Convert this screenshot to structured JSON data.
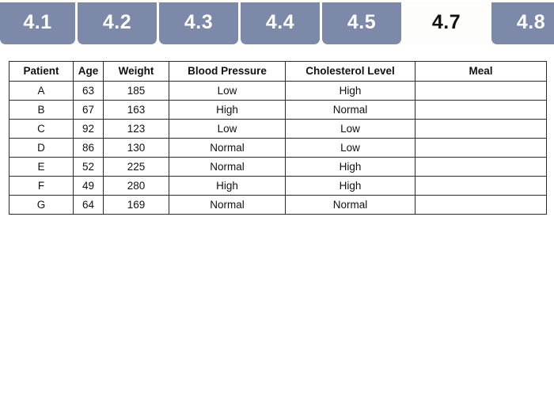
{
  "tabs": {
    "items": [
      {
        "label": "4.1",
        "active": false
      },
      {
        "label": "4.2",
        "active": false
      },
      {
        "label": "4.3",
        "active": false
      },
      {
        "label": "4.4",
        "active": false
      },
      {
        "label": "4.5",
        "active": false
      },
      {
        "label": "4.7",
        "active": true
      },
      {
        "label": "4.8",
        "active": false
      }
    ],
    "active_label": "4.7",
    "inactive_color": "#7d89a8",
    "active_color": "#fdfdfc",
    "inactive_text_color": "#ffffff",
    "active_text_color": "#111111"
  },
  "table": {
    "columns": [
      "Patient",
      "Age",
      "Weight",
      "Blood Pressure",
      "Cholesterol Level",
      "Meal"
    ],
    "rows": [
      {
        "patient": "A",
        "age": "63",
        "weight": "185",
        "blood_pressure": "Low",
        "cholesterol_level": "High",
        "meal": ""
      },
      {
        "patient": "B",
        "age": "67",
        "weight": "163",
        "blood_pressure": "High",
        "cholesterol_level": "Normal",
        "meal": ""
      },
      {
        "patient": "C",
        "age": "92",
        "weight": "123",
        "blood_pressure": "Low",
        "cholesterol_level": "Low",
        "meal": ""
      },
      {
        "patient": "D",
        "age": "86",
        "weight": "130",
        "blood_pressure": "Normal",
        "cholesterol_level": "Low",
        "meal": ""
      },
      {
        "patient": "E",
        "age": "52",
        "weight": "225",
        "blood_pressure": "Normal",
        "cholesterol_level": "High",
        "meal": ""
      },
      {
        "patient": "F",
        "age": "49",
        "weight": "280",
        "blood_pressure": "High",
        "cholesterol_level": "High",
        "meal": ""
      },
      {
        "patient": "G",
        "age": "64",
        "weight": "169",
        "blood_pressure": "Normal",
        "cholesterol_level": "Normal",
        "meal": ""
      }
    ],
    "border_color": "#2b2b2b"
  }
}
